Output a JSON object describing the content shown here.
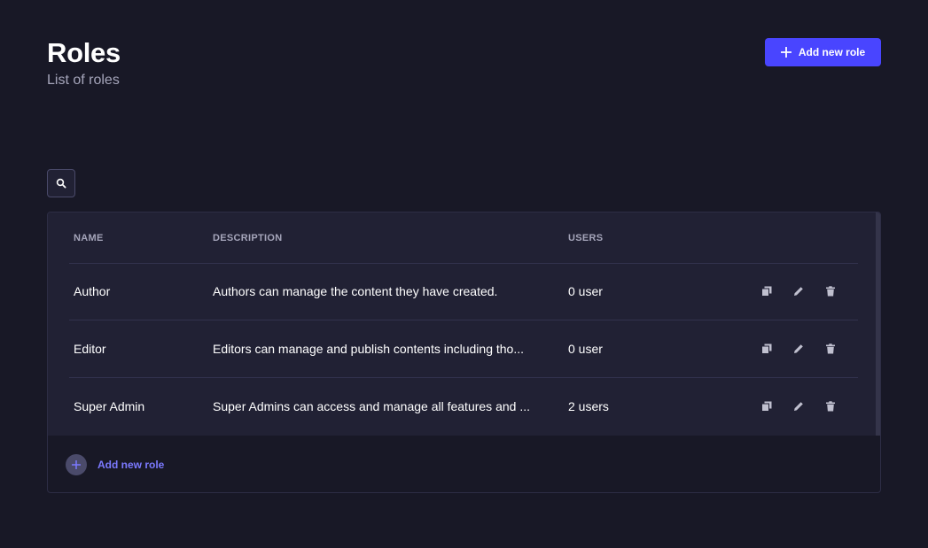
{
  "header": {
    "title": "Roles",
    "subtitle": "List of roles",
    "add_button_label": "Add new role"
  },
  "icons": {
    "search": "search-icon",
    "add": "plus-icon",
    "duplicate": "duplicate-icon",
    "edit": "pencil-icon",
    "delete": "trash-icon"
  },
  "colors": {
    "background": "#181826",
    "surface": "#212134",
    "primary": "#4945ff",
    "link": "#7b79ff",
    "muted": "#a5a5ba"
  },
  "table": {
    "columns": [
      "NAME",
      "DESCRIPTION",
      "USERS"
    ],
    "rows": [
      {
        "name": "Author",
        "description": "Authors can manage the content they have created.",
        "users": "0 user"
      },
      {
        "name": "Editor",
        "description": "Editors can manage and publish contents including tho...",
        "users": "0 user"
      },
      {
        "name": "Super Admin",
        "description": "Super Admins can access and manage all features and ...",
        "users": "2 users"
      }
    ],
    "footer_add_label": "Add new role"
  }
}
